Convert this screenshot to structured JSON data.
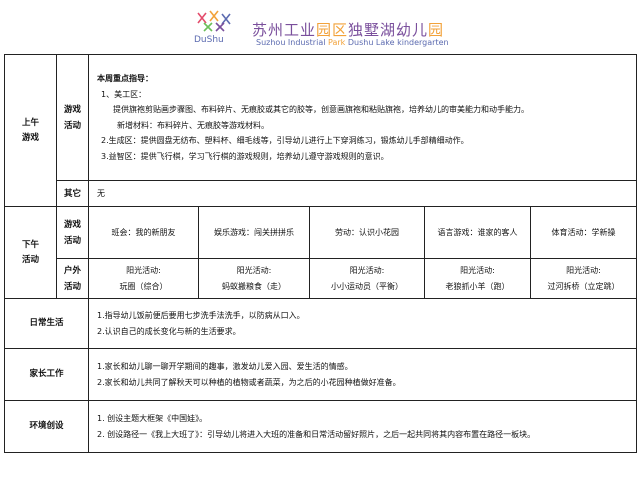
{
  "header": {
    "logo_letters": "DuShu",
    "school_name_1": "苏州工业",
    "school_name_2": "园区",
    "school_name_3": "独墅湖幼儿",
    "school_name_4": "园",
    "school_en_1": "Suzhou Industrial",
    "school_en_2": "Park",
    "school_en_3": "Dushu Lake kindergarten"
  },
  "morning": {
    "label_line1": "上午",
    "label_line2": "游戏",
    "games_label_1": "游戏",
    "games_label_2": "活动",
    "guide_title": "本周重点指导：",
    "item1_title": "1、美工区：",
    "item1_desc": "提供旗袍剪贴画步骤图、布料碎片、无痕胶或其它的胶等，创意画旗袍和粘贴旗袍，培养幼儿的审美能力和动手能力。",
    "item1_new": "新增材料：布料碎片、无痕胶等游戏材料。",
    "item2": "2.生成区：提供圆盘无纺布、塑料杯、细毛线等，引导幼儿进行上下穿洞练习，锻炼幼儿手部精细动作。",
    "item3": "3.益智区：提供飞行棋，学习飞行棋的游戏规则，培养幼儿遵守游戏规则的意识。",
    "other_label": "其它",
    "other_value": "无"
  },
  "afternoon": {
    "label_line1": "下午",
    "label_line2": "活动",
    "games_label_1": "游戏",
    "games_label_2": "活动",
    "games": [
      "班会：我的新朋友",
      "娱乐游戏：闯关拼拼乐",
      "劳动：认识小花园",
      "语言游戏：谁家的客人",
      "体育活动：学新操"
    ],
    "outdoor_label_1": "户外",
    "outdoor_label_2": "活动",
    "outdoor": [
      {
        "line1": "阳光活动:",
        "line2": "玩圈（综合）"
      },
      {
        "line1": "阳光活动:",
        "line2": "蚂蚁搬粮食（走）"
      },
      {
        "line1": "阳光活动:",
        "line2": "小小运动员（平衡）"
      },
      {
        "line1": "阳光活动:",
        "line2": "老狼抓小羊（跑）"
      },
      {
        "line1": "阳光活动:",
        "line2": "过河拆桥（立定跳）"
      }
    ]
  },
  "daily": {
    "label": "日常生活",
    "line1": "1.指导幼儿饭前便后要用七步洗手法洗手，以防病从口入。",
    "line2": "2.认识自己的成长变化与新的生活要求。"
  },
  "parents": {
    "label": "家长工作",
    "line1": "1.家长和幼儿聊一聊开学期间的趣事，激发幼儿爱入园、爱生活的情感。",
    "line2": "2.家长和幼儿共同了解秋天可以种植的植物或者蔬菜，为之后的小花园种植做好准备。"
  },
  "environment": {
    "label": "环境创设",
    "line1": "1.  创设主题大框架《中国娃》。",
    "line2": "2.  创设路径一《我上大班了》：引导幼儿将进入大班的准备和日常活动留好照片，之后一起共同将其内容布置在路径一板块。"
  },
  "colors": {
    "logo_purple": "#7a4f9c",
    "logo_orange": "#f2a23a",
    "logo_blue": "#5c6bb0"
  }
}
